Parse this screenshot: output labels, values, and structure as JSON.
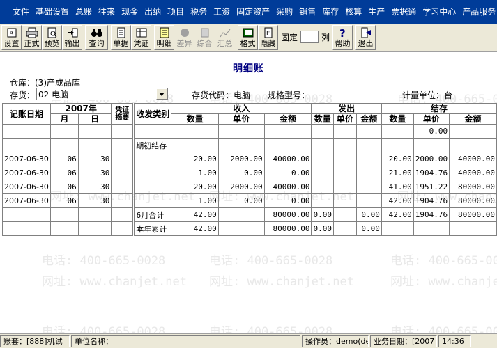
{
  "menu": [
    "文件",
    "基础设置",
    "总账",
    "往来",
    "现金",
    "出纳",
    "项目",
    "税务",
    "工资",
    "固定资产",
    "采购",
    "销售",
    "库存",
    "核算",
    "生产",
    "票据通",
    "学习中心",
    "产品服务"
  ],
  "toolbar": {
    "buttons_a": [
      {
        "label": "设置",
        "icon": "settings-icon"
      },
      {
        "label": "正式",
        "icon": "printer-icon"
      },
      {
        "label": "预览",
        "icon": "preview-icon"
      },
      {
        "label": "输出",
        "icon": "export-icon"
      }
    ],
    "query": {
      "label": "查询",
      "icon": "binoculars-icon"
    },
    "buttons_b": [
      {
        "label": "单据",
        "icon": "document-icon"
      },
      {
        "label": "凭证",
        "icon": "voucher-icon"
      }
    ],
    "buttons_c": [
      {
        "label": "明细",
        "icon": "detail-icon",
        "disabled": false
      },
      {
        "label": "差异",
        "icon": "diff-icon",
        "disabled": true
      },
      {
        "label": "综合",
        "icon": "combined-icon",
        "disabled": true
      },
      {
        "label": "汇总",
        "icon": "summary-icon",
        "disabled": true
      }
    ],
    "buttons_d": [
      {
        "label": "格式",
        "icon": "format-icon"
      },
      {
        "label": "隐藏",
        "icon": "hide-icon"
      }
    ],
    "fixed_label": "固定",
    "fixed_value": "",
    "fixed_suffix": "列",
    "help": {
      "label": "帮助",
      "icon": "help-icon"
    },
    "exit": {
      "label": "退出",
      "icon": "exit-icon"
    }
  },
  "report": {
    "title": "明细账",
    "warehouse": "仓库：(3)产成品库",
    "inventory_label": "存货：",
    "inventory_value": "02 电脑",
    "inventory_code": "存货代码：电脑",
    "spec": "规格型号：",
    "unit": "计量单位：台"
  },
  "table": {
    "header1": {
      "date": "记账日期",
      "year": "2007年",
      "voucher": "凭证摘要",
      "category": "收发类别",
      "in": "收入",
      "out": "发出",
      "bal": "结存"
    },
    "header2": {
      "month": "月",
      "day": "日",
      "qty": "数量",
      "price": "单价",
      "amount": "金额"
    },
    "rows": [
      [
        "",
        "",
        "",
        "",
        "",
        "",
        "",
        "",
        "",
        "",
        "",
        "",
        "",
        "0.00",
        "",
        "0.00"
      ],
      [
        "",
        "",
        "",
        "",
        "期初结存",
        "",
        "",
        "",
        "",
        "",
        "",
        "",
        "",
        "",
        "",
        ""
      ],
      [
        "2007-06-30",
        "06",
        "30",
        "",
        "",
        "20.00",
        "2000.00",
        "40000.00",
        "",
        "",
        "",
        "",
        "20.00",
        "2000.00",
        "40000.00",
        ""
      ],
      [
        "2007-06-30",
        "06",
        "30",
        "",
        "",
        "1.00",
        "0.00",
        "0.00",
        "",
        "",
        "",
        "",
        "21.00",
        "1904.76",
        "40000.00",
        ""
      ],
      [
        "2007-06-30",
        "06",
        "30",
        "",
        "",
        "20.00",
        "2000.00",
        "40000.00",
        "",
        "",
        "",
        "",
        "41.00",
        "1951.22",
        "80000.00",
        ""
      ],
      [
        "2007-06-30",
        "06",
        "30",
        "",
        "",
        "1.00",
        "0.00",
        "0.00",
        "",
        "",
        "",
        "",
        "42.00",
        "1904.76",
        "80000.00",
        ""
      ],
      [
        "",
        "",
        "",
        "",
        "6月合计",
        "42.00",
        "",
        "80000.00",
        "0.00",
        "",
        "0.00",
        "",
        "42.00",
        "1904.76",
        "80000.00",
        ""
      ],
      [
        "",
        "",
        "",
        "",
        "本年累计",
        "42.00",
        "",
        "80000.00",
        "0.00",
        "",
        "0.00",
        "",
        "",
        "",
        "",
        ""
      ]
    ]
  },
  "watermark": {
    "phone": "电话: 400-665-0028",
    "site": "网址: www.chanjet.net"
  },
  "status": {
    "account": "账套：[888]机试",
    "company": "单位名称：",
    "operator": "操作员：demo(de",
    "date": "业务日期：[2007",
    "time": "14:36"
  }
}
